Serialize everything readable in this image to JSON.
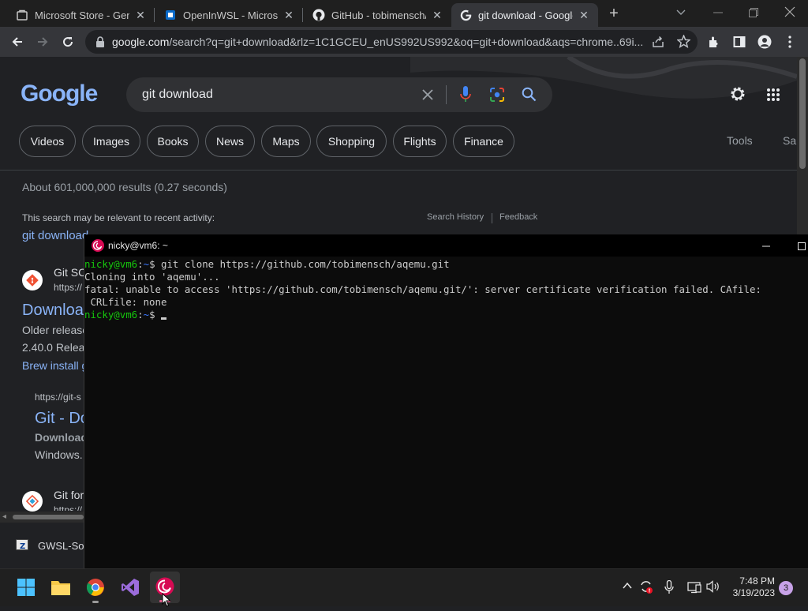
{
  "browser": {
    "tabs": [
      {
        "title": "Microsoft Store - Gene",
        "favicon": "microsoft-store-icon",
        "active": false
      },
      {
        "title": "OpenInWSL - Microsoft",
        "favicon": "openinwsl-icon",
        "active": false
      },
      {
        "title": "GitHub - tobimensch/a",
        "favicon": "github-icon",
        "active": false
      },
      {
        "title": "git download - Google",
        "favicon": "google-icon",
        "active": true
      }
    ],
    "new_tab": "+",
    "address": {
      "host": "google.com",
      "path": "/search?q=git+download&rlz=1C1GCEU_enUS992US992&oq=git+download&aqs=chrome..69i..."
    }
  },
  "google": {
    "logo": "Google",
    "query": "git download",
    "chips": [
      "Videos",
      "Images",
      "Books",
      "News",
      "Maps",
      "Shopping",
      "Flights",
      "Finance"
    ],
    "tools": "Tools",
    "safesearch_partial": "Sa",
    "result_stats": "About 601,000,000 results (0.27 seconds)",
    "recent_activity": "This search may be relevant to recent activity:",
    "search_history": "Search History",
    "feedback": "Feedback",
    "recent_link": "git download",
    "results": [
      {
        "site": "Git SC",
        "url": "https://",
        "title": "Download",
        "snippet1": "Older release",
        "snippet2": "2.40.0 Relea",
        "link": "Brew install g"
      },
      {
        "url": "https://git-s",
        "title": "Git - Do",
        "bold": "Download",
        "snippet": "Windows."
      },
      {
        "site": "Git for",
        "url": "https://"
      }
    ],
    "bottom_item": "GWSL-Sou"
  },
  "terminal": {
    "title": "nicky@vm6: ~",
    "user_host": "nicky@vm6",
    "path": "~",
    "command": "git clone https://github.com/tobimensch/aqemu.git",
    "line2": "Cloning into 'aqemu'...",
    "line3": "fatal: unable to access 'https://github.com/tobimensch/aqemu.git/': server certificate verification failed. CAfile:",
    "line4": " CRLfile: none"
  },
  "taskbar": {
    "time": "7:48 PM",
    "date": "3/19/2023",
    "notifications": "3"
  },
  "colors": {
    "accent": "#8ab4f8",
    "terminal_user": "#16c60c",
    "terminal_path": "#3b78ff",
    "debian_red": "#d70a53"
  }
}
